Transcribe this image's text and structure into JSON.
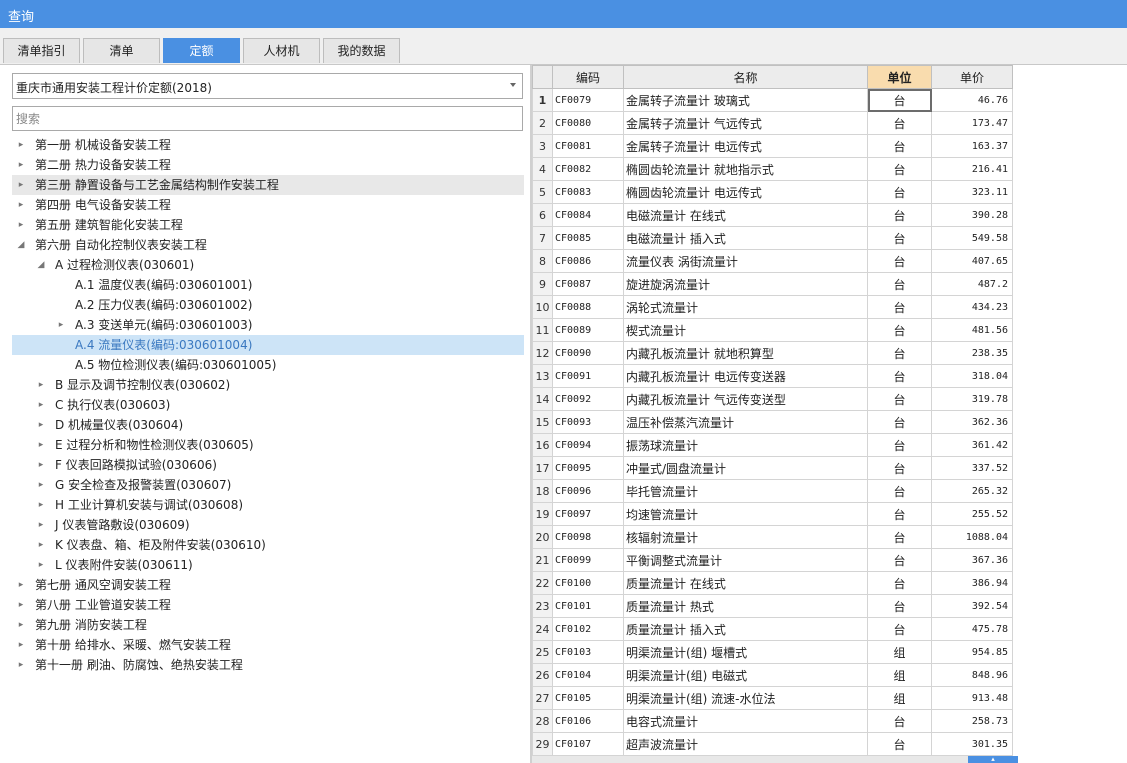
{
  "window": {
    "title": "查询"
  },
  "tabs": [
    {
      "label": "清单指引",
      "active": false
    },
    {
      "label": "清单",
      "active": false
    },
    {
      "label": "定额",
      "active": true
    },
    {
      "label": "人材机",
      "active": false
    },
    {
      "label": "我的数据",
      "active": false
    }
  ],
  "dropdown": {
    "value": "重庆市通用安装工程计价定额(2018)"
  },
  "search": {
    "placeholder": "搜索",
    "value": ""
  },
  "tree": [
    {
      "label": "第一册 机械设备安装工程",
      "level": 0,
      "caret": "▸"
    },
    {
      "label": "第二册 热力设备安装工程",
      "level": 0,
      "caret": "▸"
    },
    {
      "label": "第三册 静置设备与工艺金属结构制作安装工程",
      "level": 0,
      "caret": "▸",
      "hover": true
    },
    {
      "label": "第四册 电气设备安装工程",
      "level": 0,
      "caret": "▸"
    },
    {
      "label": "第五册 建筑智能化安装工程",
      "level": 0,
      "caret": "▸"
    },
    {
      "label": "第六册 自动化控制仪表安装工程",
      "level": 0,
      "caret": "◢"
    },
    {
      "label": "A 过程检测仪表(030601)",
      "level": 1,
      "caret": "◢"
    },
    {
      "label": "A.1 温度仪表(编码:030601001)",
      "level": 2,
      "caret": ""
    },
    {
      "label": "A.2 压力仪表(编码:030601002)",
      "level": 2,
      "caret": ""
    },
    {
      "label": "A.3 变送单元(编码:030601003)",
      "level": 2,
      "caret": "▸"
    },
    {
      "label": "A.4 流量仪表(编码:030601004)",
      "level": 2,
      "caret": "",
      "selected": true
    },
    {
      "label": "A.5 物位检测仪表(编码:030601005)",
      "level": 2,
      "caret": ""
    },
    {
      "label": "B 显示及调节控制仪表(030602)",
      "level": 1,
      "caret": "▸"
    },
    {
      "label": "C 执行仪表(030603)",
      "level": 1,
      "caret": "▸"
    },
    {
      "label": "D 机械量仪表(030604)",
      "level": 1,
      "caret": "▸"
    },
    {
      "label": "E 过程分析和物性检测仪表(030605)",
      "level": 1,
      "caret": "▸"
    },
    {
      "label": "F 仪表回路模拟试验(030606)",
      "level": 1,
      "caret": "▸"
    },
    {
      "label": "G 安全检查及报警装置(030607)",
      "level": 1,
      "caret": "▸"
    },
    {
      "label": "H 工业计算机安装与调试(030608)",
      "level": 1,
      "caret": "▸"
    },
    {
      "label": "J 仪表管路敷设(030609)",
      "level": 1,
      "caret": "▸"
    },
    {
      "label": "K 仪表盘、箱、柜及附件安装(030610)",
      "level": 1,
      "caret": "▸"
    },
    {
      "label": "L 仪表附件安装(030611)",
      "level": 1,
      "caret": "▸"
    },
    {
      "label": "第七册 通风空调安装工程",
      "level": 0,
      "caret": "▸"
    },
    {
      "label": "第八册 工业管道安装工程",
      "level": 0,
      "caret": "▸"
    },
    {
      "label": "第九册 消防安装工程",
      "level": 0,
      "caret": "▸"
    },
    {
      "label": "第十册 给排水、采暖、燃气安装工程",
      "level": 0,
      "caret": "▸"
    },
    {
      "label": "第十一册 刷油、防腐蚀、绝热安装工程",
      "level": 0,
      "caret": "▸"
    }
  ],
  "grid": {
    "headers": {
      "code": "编码",
      "name": "名称",
      "unit": "单位",
      "price": "单价"
    },
    "rows": [
      {
        "n": "1",
        "code": "CF0079",
        "name": "金属转子流量计 玻璃式",
        "unit": "台",
        "price": "46.76",
        "current": true
      },
      {
        "n": "2",
        "code": "CF0080",
        "name": "金属转子流量计 气远传式",
        "unit": "台",
        "price": "173.47"
      },
      {
        "n": "3",
        "code": "CF0081",
        "name": "金属转子流量计 电远传式",
        "unit": "台",
        "price": "163.37"
      },
      {
        "n": "4",
        "code": "CF0082",
        "name": "椭圆齿轮流量计 就地指示式",
        "unit": "台",
        "price": "216.41"
      },
      {
        "n": "5",
        "code": "CF0083",
        "name": "椭圆齿轮流量计 电远传式",
        "unit": "台",
        "price": "323.11"
      },
      {
        "n": "6",
        "code": "CF0084",
        "name": "电磁流量计 在线式",
        "unit": "台",
        "price": "390.28"
      },
      {
        "n": "7",
        "code": "CF0085",
        "name": "电磁流量计 插入式",
        "unit": "台",
        "price": "549.58"
      },
      {
        "n": "8",
        "code": "CF0086",
        "name": "流量仪表 涡街流量计",
        "unit": "台",
        "price": "407.65"
      },
      {
        "n": "9",
        "code": "CF0087",
        "name": "旋进旋涡流量计",
        "unit": "台",
        "price": "487.2"
      },
      {
        "n": "10",
        "code": "CF0088",
        "name": "涡轮式流量计",
        "unit": "台",
        "price": "434.23"
      },
      {
        "n": "11",
        "code": "CF0089",
        "name": "楔式流量计",
        "unit": "台",
        "price": "481.56"
      },
      {
        "n": "12",
        "code": "CF0090",
        "name": "内藏孔板流量计 就地积算型",
        "unit": "台",
        "price": "238.35"
      },
      {
        "n": "13",
        "code": "CF0091",
        "name": "内藏孔板流量计 电远传变送器",
        "unit": "台",
        "price": "318.04"
      },
      {
        "n": "14",
        "code": "CF0092",
        "name": "内藏孔板流量计 气远传变送型",
        "unit": "台",
        "price": "319.78"
      },
      {
        "n": "15",
        "code": "CF0093",
        "name": "温压补偿蒸汽流量计",
        "unit": "台",
        "price": "362.36"
      },
      {
        "n": "16",
        "code": "CF0094",
        "name": "振荡球流量计",
        "unit": "台",
        "price": "361.42"
      },
      {
        "n": "17",
        "code": "CF0095",
        "name": "冲量式/圆盘流量计",
        "unit": "台",
        "price": "337.52"
      },
      {
        "n": "18",
        "code": "CF0096",
        "name": "毕托管流量计",
        "unit": "台",
        "price": "265.32"
      },
      {
        "n": "19",
        "code": "CF0097",
        "name": "均速管流量计",
        "unit": "台",
        "price": "255.52"
      },
      {
        "n": "20",
        "code": "CF0098",
        "name": "核辐射流量计",
        "unit": "台",
        "price": "1088.04"
      },
      {
        "n": "21",
        "code": "CF0099",
        "name": "平衡调整式流量计",
        "unit": "台",
        "price": "367.36"
      },
      {
        "n": "22",
        "code": "CF0100",
        "name": "质量流量计 在线式",
        "unit": "台",
        "price": "386.94"
      },
      {
        "n": "23",
        "code": "CF0101",
        "name": "质量流量计 热式",
        "unit": "台",
        "price": "392.54"
      },
      {
        "n": "24",
        "code": "CF0102",
        "name": "质量流量计 插入式",
        "unit": "台",
        "price": "475.78"
      },
      {
        "n": "25",
        "code": "CF0103",
        "name": "明渠流量计(组) 堰槽式",
        "unit": "组",
        "price": "954.85"
      },
      {
        "n": "26",
        "code": "CF0104",
        "name": "明渠流量计(组) 电磁式",
        "unit": "组",
        "price": "848.96"
      },
      {
        "n": "27",
        "code": "CF0105",
        "name": "明渠流量计(组) 流速-水位法",
        "unit": "组",
        "price": "913.48"
      },
      {
        "n": "28",
        "code": "CF0106",
        "name": "电容式流量计",
        "unit": "台",
        "price": "258.73"
      },
      {
        "n": "29",
        "code": "CF0107",
        "name": "超声波流量计",
        "unit": "台",
        "price": "301.35"
      }
    ]
  },
  "colors": {
    "accent": "#4a90e2",
    "unit_header": "#f9dcae",
    "selection": "#cde4f7"
  }
}
